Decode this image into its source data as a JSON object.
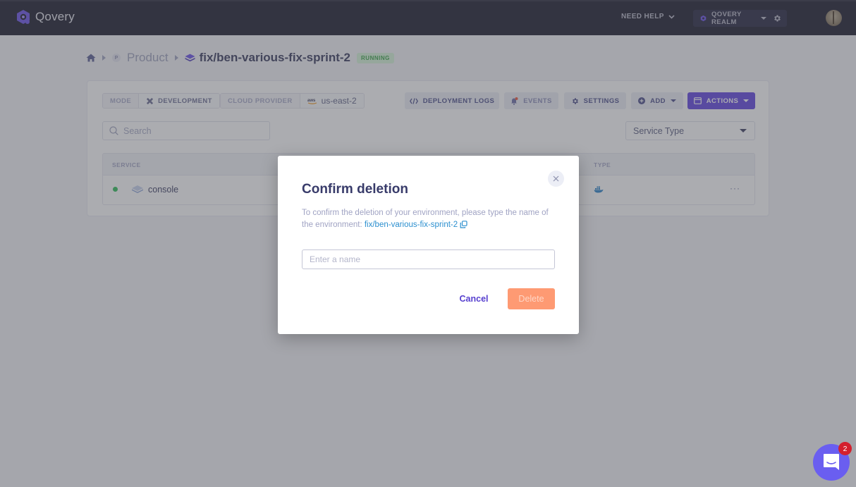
{
  "topbar": {
    "brand": "Qovery",
    "need_help_label": "NEED HELP",
    "organization_label": "QOVERY REALM",
    "icons": {
      "logo": "qovery-logo-icon",
      "need_help_chevron": "chevron-down-icon",
      "org_caret": "caret-down-icon",
      "settings": "gear-icon",
      "avatar": "user-avatar"
    }
  },
  "breadcrumb": {
    "project_initial": "P",
    "project": "Product",
    "environment": "fix/ben-various-fix-sprint-2",
    "status": "RUNNING"
  },
  "env_info": {
    "mode_label": "MODE",
    "mode_value": "DEVELOPMENT",
    "provider_label": "CLOUD PROVIDER",
    "provider_value": "us-east-2",
    "provider_logo": "aws"
  },
  "toolbar": {
    "deployment_logs": "DEPLOYMENT LOGS",
    "events": "EVENTS",
    "settings": "SETTINGS",
    "add": "ADD",
    "actions": "ACTIONS"
  },
  "filters": {
    "search_placeholder": "Search",
    "service_type": "Service Type"
  },
  "table": {
    "columns": [
      "SERVICE",
      "TYPE"
    ],
    "rows": [
      {
        "status": "running",
        "name": "console",
        "type": "docker",
        "menu": "···"
      }
    ]
  },
  "modal": {
    "title": "Confirm deletion",
    "description": "To confirm the deletion of your environment, please type the name of the environment: ",
    "environment_name": "fix/ben-various-fix-sprint-2",
    "input_placeholder": "Enter a name",
    "input_value": "",
    "cancel_label": "Cancel",
    "delete_label": "Delete",
    "delete_disabled": true
  },
  "chat": {
    "unread_count": "2"
  },
  "colors": {
    "brand": "#6043e0",
    "nav_bg": "#1a1a2b",
    "running_green": "#2fbe59",
    "link": "#2b8fcf",
    "delete": "#fe9a73",
    "chat": "#6a5ef0",
    "badge_red": "#d4202e"
  }
}
